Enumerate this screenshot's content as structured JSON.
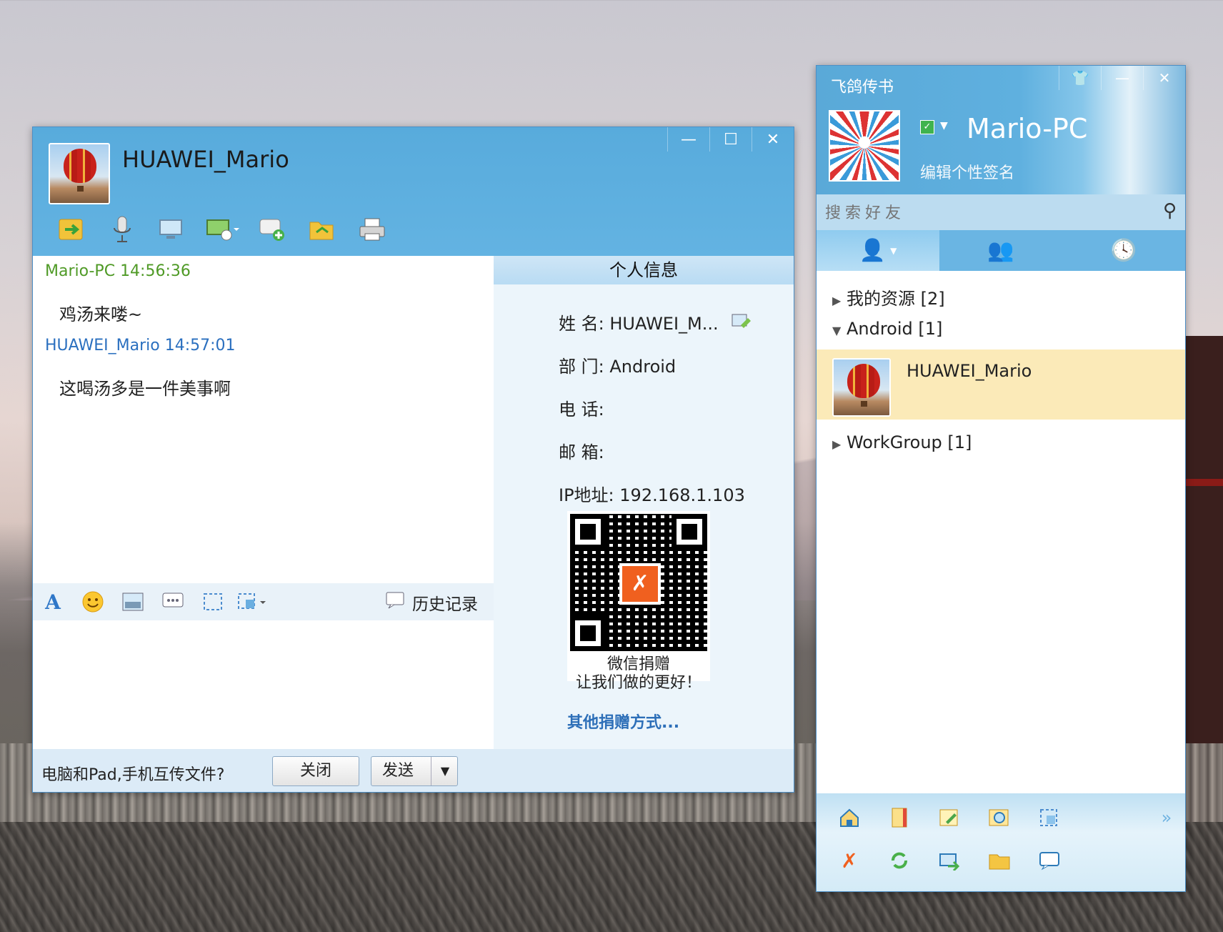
{
  "chat_window": {
    "contact_name": "HUAWEI_Mario",
    "window_buttons": {
      "minimize": "—",
      "maximize": "☐",
      "close": "✕"
    },
    "toolbar_icons": [
      "send-file-icon",
      "voice-icon",
      "remote-desktop-icon",
      "screen-share-icon",
      "group-chat-icon",
      "shared-folder-icon",
      "print-icon"
    ],
    "messages": [
      {
        "sender": "Mario-PC",
        "time": "14:56:36",
        "text": "鸡汤来喽~",
        "color": "#4f9a26"
      },
      {
        "sender": "HUAWEI_Mario",
        "time": "14:57:01",
        "text": "这喝汤多是一件美事啊",
        "color": "#2a6fbf"
      }
    ],
    "format_icons": [
      "font-icon",
      "emoji-icon",
      "image-icon",
      "quick-reply-icon",
      "screenshot-icon",
      "capture-icon"
    ],
    "history_label": "历史记录",
    "info_panel": {
      "title": "个人信息",
      "name_label": "姓  名:",
      "name_value": "HUAWEI_M...",
      "dept_label": "部  门:",
      "dept_value": "Android",
      "phone_label": "电  话:",
      "phone_value": "",
      "email_label": "邮  箱:",
      "email_value": "",
      "ip_label": "IP地址:",
      "ip_value": "192.168.1.103",
      "qr_caption_1": "微信捐赠",
      "qr_caption_2": "让我们做的更好！",
      "donate_link": "其他捐赠方式..."
    },
    "footer": {
      "tip": "电脑和Pad,手机互传文件?",
      "close_label": "关闭",
      "send_label": "发送"
    }
  },
  "main_panel": {
    "app_title": "飞鸽传书",
    "user_name": "Mario-PC",
    "signature": "编辑个性签名",
    "search_placeholder": "搜索好友",
    "groups": [
      {
        "label": "我的资源 [2]",
        "expanded": false
      },
      {
        "label": "Android [1]",
        "expanded": true
      },
      {
        "label": "WorkGroup [1]",
        "expanded": false
      }
    ],
    "contacts": [
      {
        "name": "HUAWEI_Mario",
        "group": "Android"
      }
    ],
    "bottom_icons_row1": [
      "home-icon",
      "notepad-icon",
      "edit-icon",
      "search-image-icon",
      "screenshot-icon"
    ],
    "bottom_icons_row2": [
      "feige-logo-icon",
      "refresh-icon",
      "transfer-icon",
      "folder-icon",
      "message-icon"
    ],
    "accent_color": "#5aaedc"
  }
}
